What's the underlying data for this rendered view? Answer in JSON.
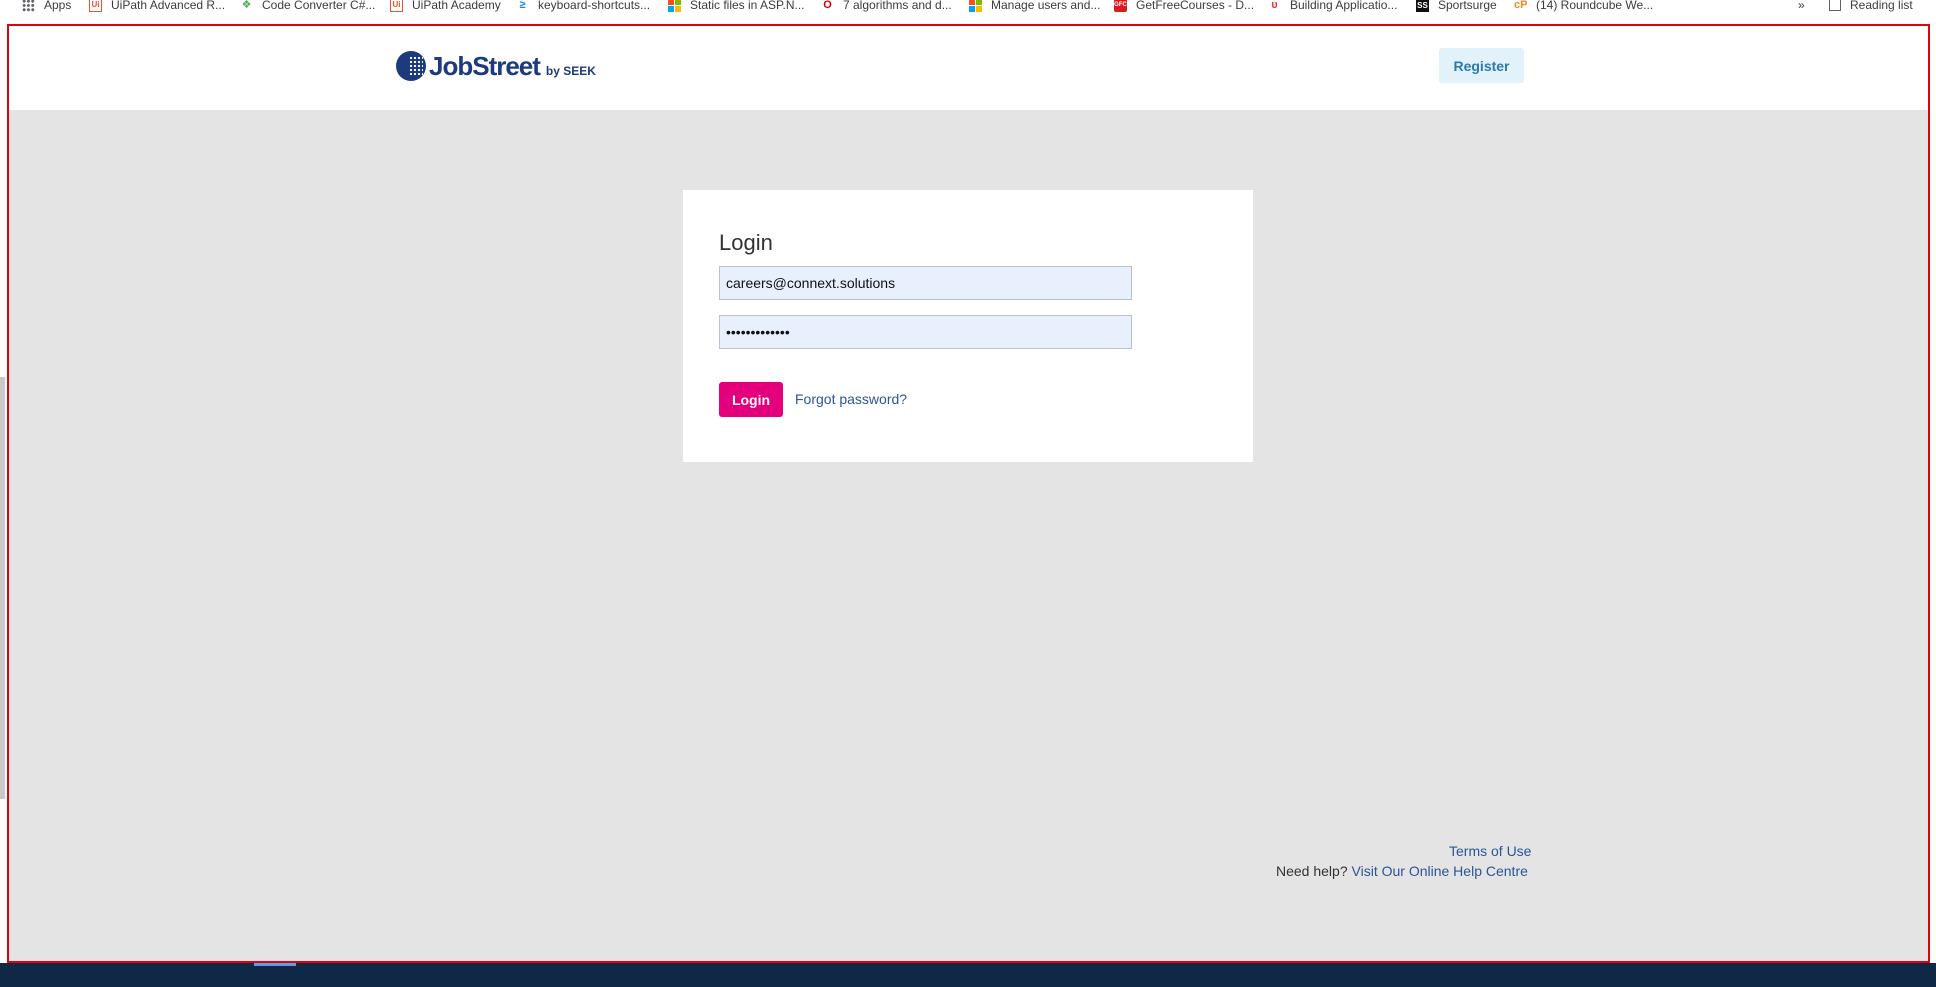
{
  "bookmarks": [
    {
      "label": "Apps",
      "icon": "apps-grid-icon"
    },
    {
      "label": "UiPath Advanced R...",
      "icon": "uipath-icon",
      "glyph": "Ui"
    },
    {
      "label": "Code Converter C#...",
      "icon": "code-converter-icon",
      "glyph": "❖"
    },
    {
      "label": "UiPath Academy",
      "icon": "uipath-icon",
      "glyph": "Ui"
    },
    {
      "label": "keyboard-shortcuts...",
      "icon": "vscode-icon",
      "glyph": "≥"
    },
    {
      "label": "Static files in ASP.N...",
      "icon": "microsoft-icon"
    },
    {
      "label": "7 algorithms and d...",
      "icon": "opera-icon",
      "glyph": "O"
    },
    {
      "label": "Manage users and...",
      "icon": "microsoft-icon"
    },
    {
      "label": "GetFreeCourses - D...",
      "icon": "gfc-icon",
      "glyph": "GFC"
    },
    {
      "label": "Building Applicatio...",
      "icon": "udemy-icon",
      "glyph": "υ"
    },
    {
      "label": "Sportsurge",
      "icon": "sportsurge-icon",
      "glyph": "SS"
    },
    {
      "label": "(14) Roundcube We...",
      "icon": "roundcube-icon",
      "glyph": "cP"
    }
  ],
  "bookmarks_overflow": "»",
  "reading_list": "Reading list",
  "header": {
    "brand": "JobStreet",
    "brand_sub": "by SEEK",
    "register_label": "Register"
  },
  "login": {
    "title": "Login",
    "email_value": "careers@connext.solutions",
    "password_value": "•••••••••••••",
    "submit_label": "Login",
    "forgot_label": "Forgot password?"
  },
  "footer": {
    "terms_label": "Terms of Use",
    "help_prefix": "Need help?",
    "help_link": "Visit Our Online Help Centre"
  },
  "colors": {
    "brand_navy": "#1c3a7e",
    "login_pink": "#e4007c",
    "link_blue": "#2b5597",
    "page_gray": "#e4e4e4",
    "frame_red": "#e0000f"
  }
}
